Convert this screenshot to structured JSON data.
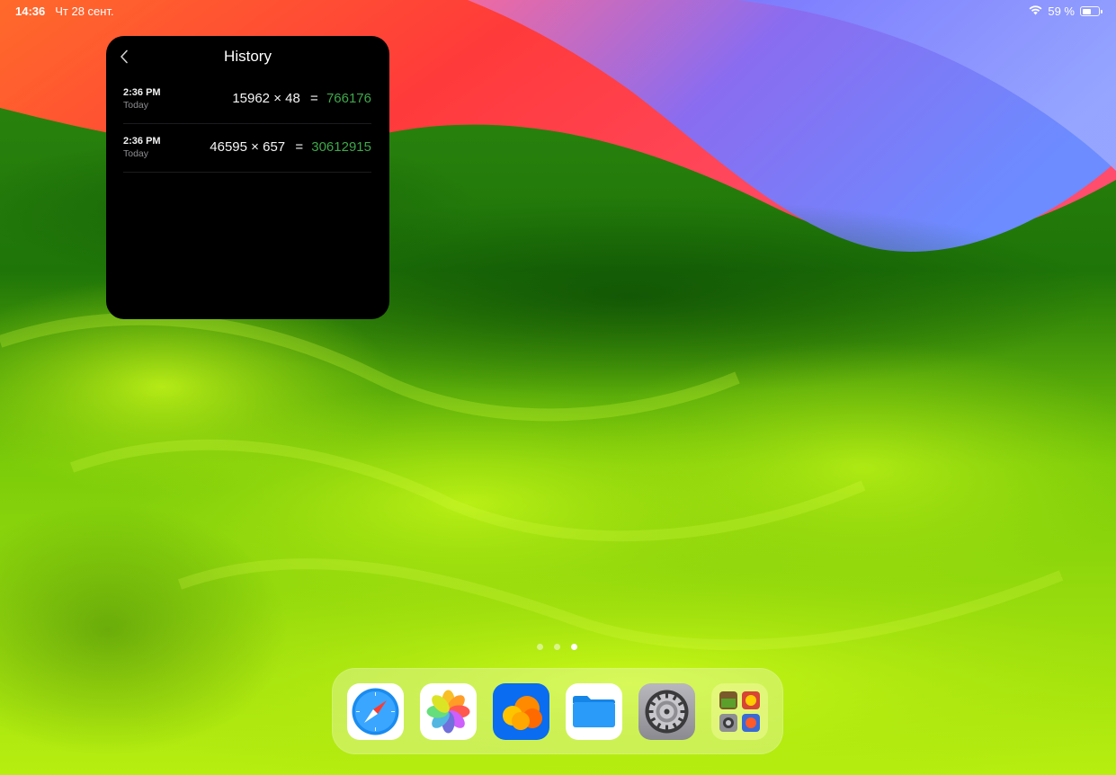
{
  "status_bar": {
    "time": "14:36",
    "date": "Чт 28 сент.",
    "battery": "59 %",
    "battery_level": 0.59
  },
  "history": {
    "title": "History",
    "entries": [
      {
        "time": "2:36 PM",
        "date": "Today",
        "a": "15962",
        "op": "×",
        "b": "48",
        "eq": "=",
        "result": "766176"
      },
      {
        "time": "2:36 PM",
        "date": "Today",
        "a": "46595",
        "op": "×",
        "b": "657",
        "eq": "=",
        "result": "30612915"
      }
    ]
  },
  "page_indicator": {
    "count": 3,
    "active": 3
  },
  "dock": {
    "apps": [
      "safari-icon",
      "photos-icon",
      "cloud-drive-icon",
      "files-icon",
      "settings-icon",
      "folder-icon"
    ]
  },
  "colors": {
    "result_green": "#3ea84a",
    "panel_bg": "#000000"
  }
}
